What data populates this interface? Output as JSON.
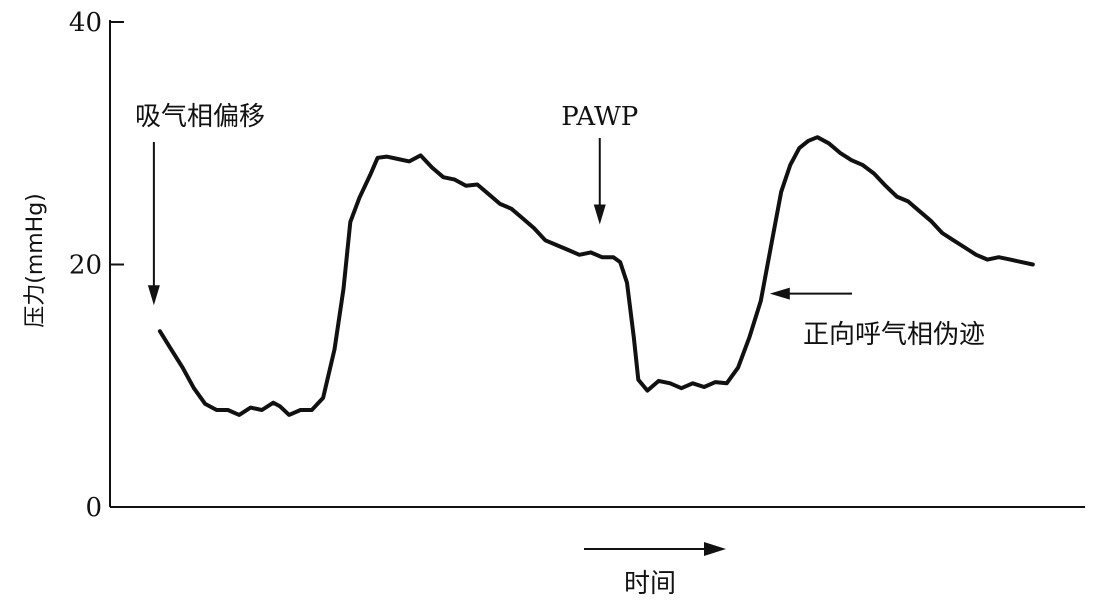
{
  "chart_data": {
    "type": "line",
    "title": "",
    "ylabel": "压力(mmHg)",
    "xlabel": "时间",
    "ylim": [
      0,
      40
    ],
    "yticks": [
      0,
      20,
      40
    ],
    "grid": false,
    "series": [
      {
        "values": [
          [
            0.0,
            14.5
          ],
          [
            0.5,
            13.0
          ],
          [
            1.0,
            11.5
          ],
          [
            1.5,
            9.8
          ],
          [
            2.0,
            8.5
          ],
          [
            2.5,
            8.0
          ],
          [
            3.0,
            8.0
          ],
          [
            3.5,
            7.6
          ],
          [
            4.0,
            8.2
          ],
          [
            4.5,
            8.0
          ],
          [
            5.0,
            8.6
          ],
          [
            5.3,
            8.3
          ],
          [
            5.7,
            7.6
          ],
          [
            6.2,
            8.0
          ],
          [
            6.7,
            8.0
          ],
          [
            7.2,
            9.0
          ],
          [
            7.7,
            13.0
          ],
          [
            8.1,
            18.0
          ],
          [
            8.4,
            23.5
          ],
          [
            8.8,
            25.5
          ],
          [
            9.3,
            27.5
          ],
          [
            9.6,
            28.8
          ],
          [
            10.0,
            28.9
          ],
          [
            10.5,
            28.7
          ],
          [
            11.0,
            28.5
          ],
          [
            11.5,
            29.0
          ],
          [
            12.0,
            28.0
          ],
          [
            12.5,
            27.2
          ],
          [
            13.0,
            27.0
          ],
          [
            13.5,
            26.5
          ],
          [
            14.0,
            26.6
          ],
          [
            14.5,
            25.8
          ],
          [
            15.0,
            25.0
          ],
          [
            15.5,
            24.6
          ],
          [
            16.0,
            23.8
          ],
          [
            16.5,
            23.0
          ],
          [
            17.0,
            22.0
          ],
          [
            17.5,
            21.6
          ],
          [
            18.0,
            21.2
          ],
          [
            18.5,
            20.8
          ],
          [
            19.0,
            21.0
          ],
          [
            19.5,
            20.6
          ],
          [
            20.0,
            20.6
          ],
          [
            20.3,
            20.2
          ],
          [
            20.6,
            18.5
          ],
          [
            20.9,
            14.0
          ],
          [
            21.1,
            10.5
          ],
          [
            21.5,
            9.6
          ],
          [
            22.0,
            10.4
          ],
          [
            22.5,
            10.2
          ],
          [
            23.0,
            9.8
          ],
          [
            23.5,
            10.2
          ],
          [
            24.0,
            9.9
          ],
          [
            24.5,
            10.3
          ],
          [
            25.0,
            10.2
          ],
          [
            25.5,
            11.5
          ],
          [
            26.0,
            14.0
          ],
          [
            26.5,
            17.0
          ],
          [
            27.0,
            22.0
          ],
          [
            27.4,
            26.0
          ],
          [
            27.8,
            28.2
          ],
          [
            28.2,
            29.6
          ],
          [
            28.6,
            30.2
          ],
          [
            29.0,
            30.5
          ],
          [
            29.5,
            30.0
          ],
          [
            30.0,
            29.2
          ],
          [
            30.5,
            28.6
          ],
          [
            31.0,
            28.2
          ],
          [
            31.5,
            27.5
          ],
          [
            32.0,
            26.5
          ],
          [
            32.5,
            25.6
          ],
          [
            33.0,
            25.2
          ],
          [
            33.5,
            24.4
          ],
          [
            34.0,
            23.6
          ],
          [
            34.5,
            22.6
          ],
          [
            35.0,
            22.0
          ],
          [
            35.5,
            21.4
          ],
          [
            36.0,
            20.8
          ],
          [
            36.5,
            20.4
          ],
          [
            37.0,
            20.6
          ],
          [
            37.5,
            20.4
          ],
          [
            38.0,
            20.2
          ],
          [
            38.5,
            20.0
          ]
        ]
      }
    ],
    "xlim": [
      -2.2,
      40.8
    ],
    "annotations": [
      {
        "text": "吸气相偏移",
        "x": 0.0,
        "y": 14.5,
        "direction": "down"
      },
      {
        "text": "PAWP",
        "x": 19.4,
        "y": 23.3,
        "direction": "down"
      },
      {
        "text": "正向呼气相伪迹",
        "x": 26.9,
        "y": 17.6,
        "direction": "left"
      }
    ]
  }
}
